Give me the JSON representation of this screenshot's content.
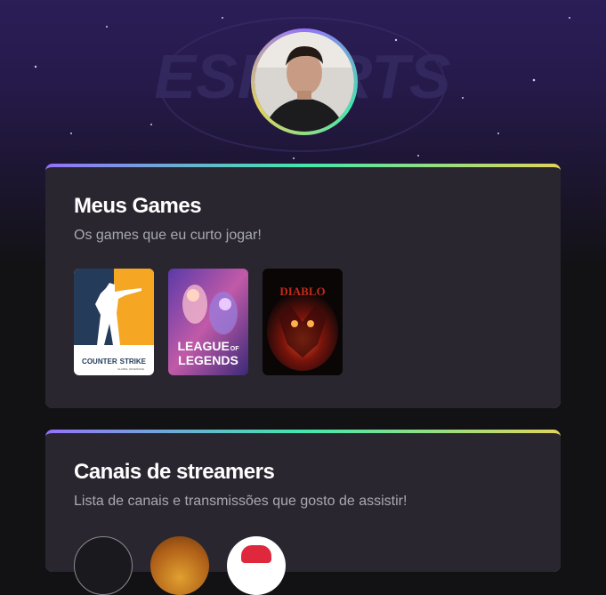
{
  "hero": {
    "background_text": "ESPORTS"
  },
  "profile": {
    "avatar_icon": "user-avatar-photo"
  },
  "games_section": {
    "title": "Meus Games",
    "subtitle": "Os games que eu curto jogar!",
    "games": [
      {
        "name": "Counter Strike",
        "cover_text_main": "COUNTER",
        "cover_text_b": "STRIKE",
        "cover_sub": "GLOBAL OFFENSIVE"
      },
      {
        "name": "League of Legends",
        "cover_line1": "LEAGUE",
        "cover_of": "OF",
        "cover_line2": "LEGENDS"
      },
      {
        "name": "Diablo",
        "cover_text": "DIABLO"
      }
    ]
  },
  "streamers_section": {
    "title": "Canais de streamers",
    "subtitle": "Lista de canais e transmissões que gosto de assistir!"
  },
  "colors": {
    "accent_gradient": [
      "#9572fc",
      "#43e7ad",
      "#e2d45c"
    ],
    "card_bg": "#29262f",
    "page_bg": "#121214"
  }
}
